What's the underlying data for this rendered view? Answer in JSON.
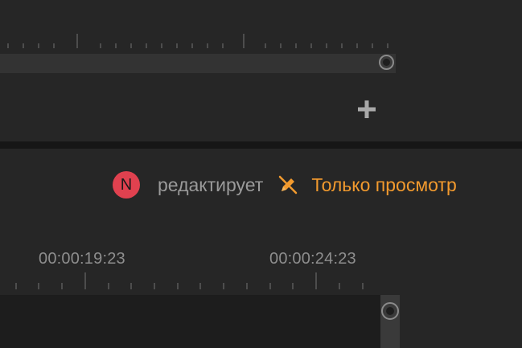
{
  "status": {
    "user_initial": "N",
    "editing_label": "редактирует",
    "view_only_label": "Только просмотр",
    "avatar_color": "#e0414f",
    "accent_color": "#f29a2e"
  },
  "timeline": {
    "timecodes": [
      "00:00:19:23",
      "00:00:24:23"
    ]
  },
  "icons": {
    "add": "plus-icon",
    "view_only": "pencil-crossed-icon"
  }
}
